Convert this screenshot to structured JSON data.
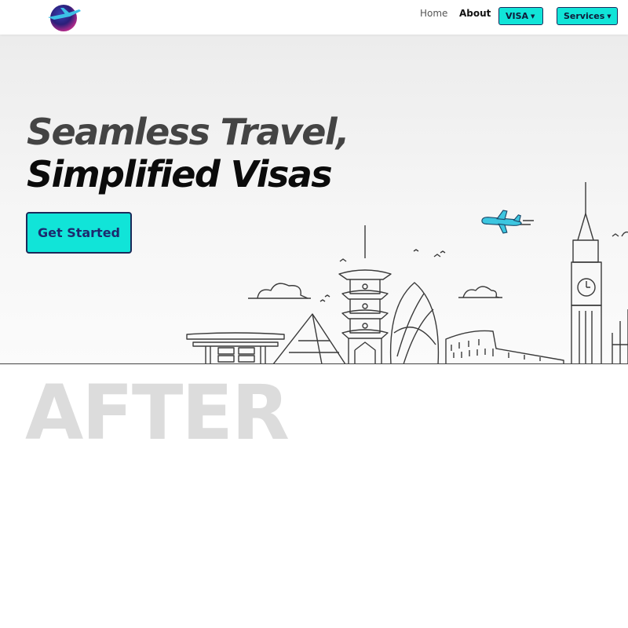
{
  "nav": {
    "logo_icon": "globe-airplane-logo-icon",
    "home_label": "Home",
    "about_label": "About",
    "visa_label": "VISA",
    "services_label": "Services",
    "accent_color": "#11e4d8"
  },
  "hero": {
    "headline_line1": "Seamless Travel,",
    "headline_line2": "Simplified Visas",
    "cta_label": "Get Started",
    "illustration": "world-landmarks-skyline",
    "plane_icon": "airplane-icon"
  },
  "watermark": "AFTER"
}
